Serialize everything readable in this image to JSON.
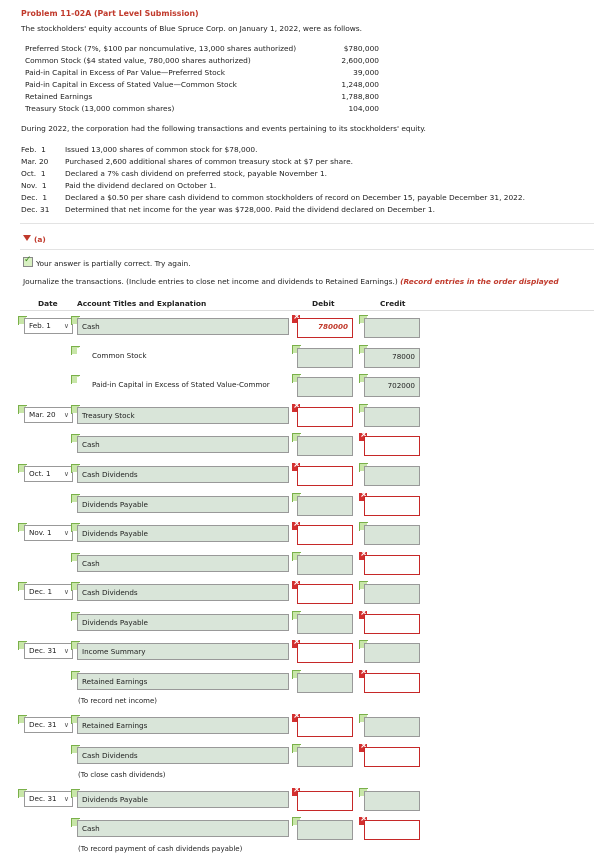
{
  "problem": {
    "title": "Problem 11-02A (Part Level Submission)",
    "intro": "The stockholders' equity accounts of Blue Spruce Corp. on January 1, 2022, were as follows."
  },
  "equity": [
    {
      "label": "Preferred Stock (7%, $100 par noncumulative, 13,000 shares authorized)",
      "amount": "$780,000"
    },
    {
      "label": "Common Stock ($4 stated value, 780,000 shares authorized)",
      "amount": "2,600,000"
    },
    {
      "label": "Paid-in Capital in Excess of Par Value—Preferred Stock",
      "amount": "39,000"
    },
    {
      "label": "Paid-in Capital in Excess of Stated Value—Common Stock",
      "amount": "1,248,000"
    },
    {
      "label": "Retained Earnings",
      "amount": "1,788,800"
    },
    {
      "label": "Treasury Stock (13,000 common shares)",
      "amount": "104,000"
    }
  ],
  "during": "During 2022, the corporation had the following transactions and events pertaining to its stockholders' equity.",
  "events": [
    {
      "date": "Feb.  1",
      "text": "Issued 13,000 shares of common stock for $78,000."
    },
    {
      "date": "Mar. 20",
      "text": "Purchased 2,600 additional shares of common treasury stock at $7 per share."
    },
    {
      "date": "Oct.  1",
      "text": "Declared a 7% cash dividend on preferred stock, payable November 1."
    },
    {
      "date": "Nov.  1",
      "text": "Paid the dividend declared on October 1."
    },
    {
      "date": "Dec.  1",
      "text": "Declared a $0.50 per share cash dividend to common stockholders of record on December 15, payable December 31, 2022."
    },
    {
      "date": "Dec. 31",
      "text": "Determined that net income for the year was $728,000. Paid the dividend declared on December 1."
    }
  ],
  "part": {
    "label": "(a)",
    "status": "Your answer is partially correct.  Try again.",
    "instruction": "Journalize the transactions. (Include entries to close net income and dividends to Retained Earnings.) ",
    "instruction_red": "(Record entries in the order displayed"
  },
  "table_headers": {
    "date": "Date",
    "account": "Account Titles and Explanation",
    "debit": "Debit",
    "credit": "Credit"
  },
  "rows": [
    {
      "date": "Feb. 1",
      "account": "Cash",
      "debit": "780000",
      "credit": "",
      "indent": false,
      "dmark": "bad",
      "cmark": "ok",
      "dred": false,
      "cred": false
    },
    {
      "date": "",
      "account": "Common Stock",
      "debit": "",
      "credit": "78000",
      "indent": true,
      "dmark": "ok",
      "cmark": "ok",
      "plain": true
    },
    {
      "date": "",
      "account": "Paid-in Capital in Excess of Stated Value-Commor",
      "debit": "",
      "credit": "702000",
      "indent": true,
      "dmark": "ok",
      "cmark": "ok",
      "plain": true
    },
    {
      "date": "Mar. 20",
      "account": "Treasury Stock",
      "debit": "",
      "credit": "",
      "indent": false,
      "dmark": "bad",
      "cmark": "ok",
      "dred": true
    },
    {
      "date": "",
      "account": "Cash",
      "debit": "",
      "credit": "",
      "indent": true,
      "dmark": "ok",
      "cmark": "bad",
      "cred": true
    },
    {
      "date": "Oct. 1",
      "account": "Cash Dividends",
      "debit": "",
      "credit": "",
      "indent": false,
      "dmark": "bad",
      "cmark": "ok",
      "dred": true
    },
    {
      "date": "",
      "account": "Dividends Payable",
      "debit": "",
      "credit": "",
      "indent": true,
      "dmark": "ok",
      "cmark": "bad",
      "cred": true
    },
    {
      "date": "Nov. 1",
      "account": "Dividends Payable",
      "debit": "",
      "credit": "",
      "indent": false,
      "dmark": "bad",
      "cmark": "ok",
      "dred": true
    },
    {
      "date": "",
      "account": "Cash",
      "debit": "",
      "credit": "",
      "indent": true,
      "dmark": "ok",
      "cmark": "bad",
      "cred": true
    },
    {
      "date": "Dec. 1",
      "account": "Cash Dividends",
      "debit": "",
      "credit": "",
      "indent": false,
      "dmark": "bad",
      "cmark": "ok",
      "dred": true
    },
    {
      "date": "",
      "account": "Dividends Payable",
      "debit": "",
      "credit": "",
      "indent": true,
      "dmark": "ok",
      "cmark": "bad",
      "cred": true
    },
    {
      "date": "Dec. 31",
      "account": "Income Summary",
      "debit": "",
      "credit": "",
      "indent": false,
      "dmark": "bad",
      "cmark": "ok",
      "dred": true
    },
    {
      "date": "",
      "account": "Retained Earnings",
      "debit": "",
      "credit": "",
      "indent": true,
      "dmark": "ok",
      "cmark": "bad",
      "cred": true
    },
    {
      "date": "Dec. 31",
      "account": "Retained Earnings",
      "debit": "",
      "credit": "",
      "indent": false,
      "dmark": "bad",
      "cmark": "ok",
      "dred": true
    },
    {
      "date": "",
      "account": "Cash Dividends",
      "debit": "",
      "credit": "",
      "indent": true,
      "dmark": "ok",
      "cmark": "bad",
      "cred": true
    },
    {
      "date": "Dec. 31",
      "account": "Dividends Payable",
      "debit": "",
      "credit": "",
      "indent": false,
      "dmark": "bad",
      "cmark": "ok",
      "dred": true
    },
    {
      "date": "",
      "account": "Cash",
      "debit": "",
      "credit": "",
      "indent": true,
      "dmark": "ok",
      "cmark": "bad",
      "cred": true
    }
  ],
  "notes": [
    "(To record net income)",
    "(To close cash dividends)",
    "(To record payment of cash dividends payable)"
  ]
}
